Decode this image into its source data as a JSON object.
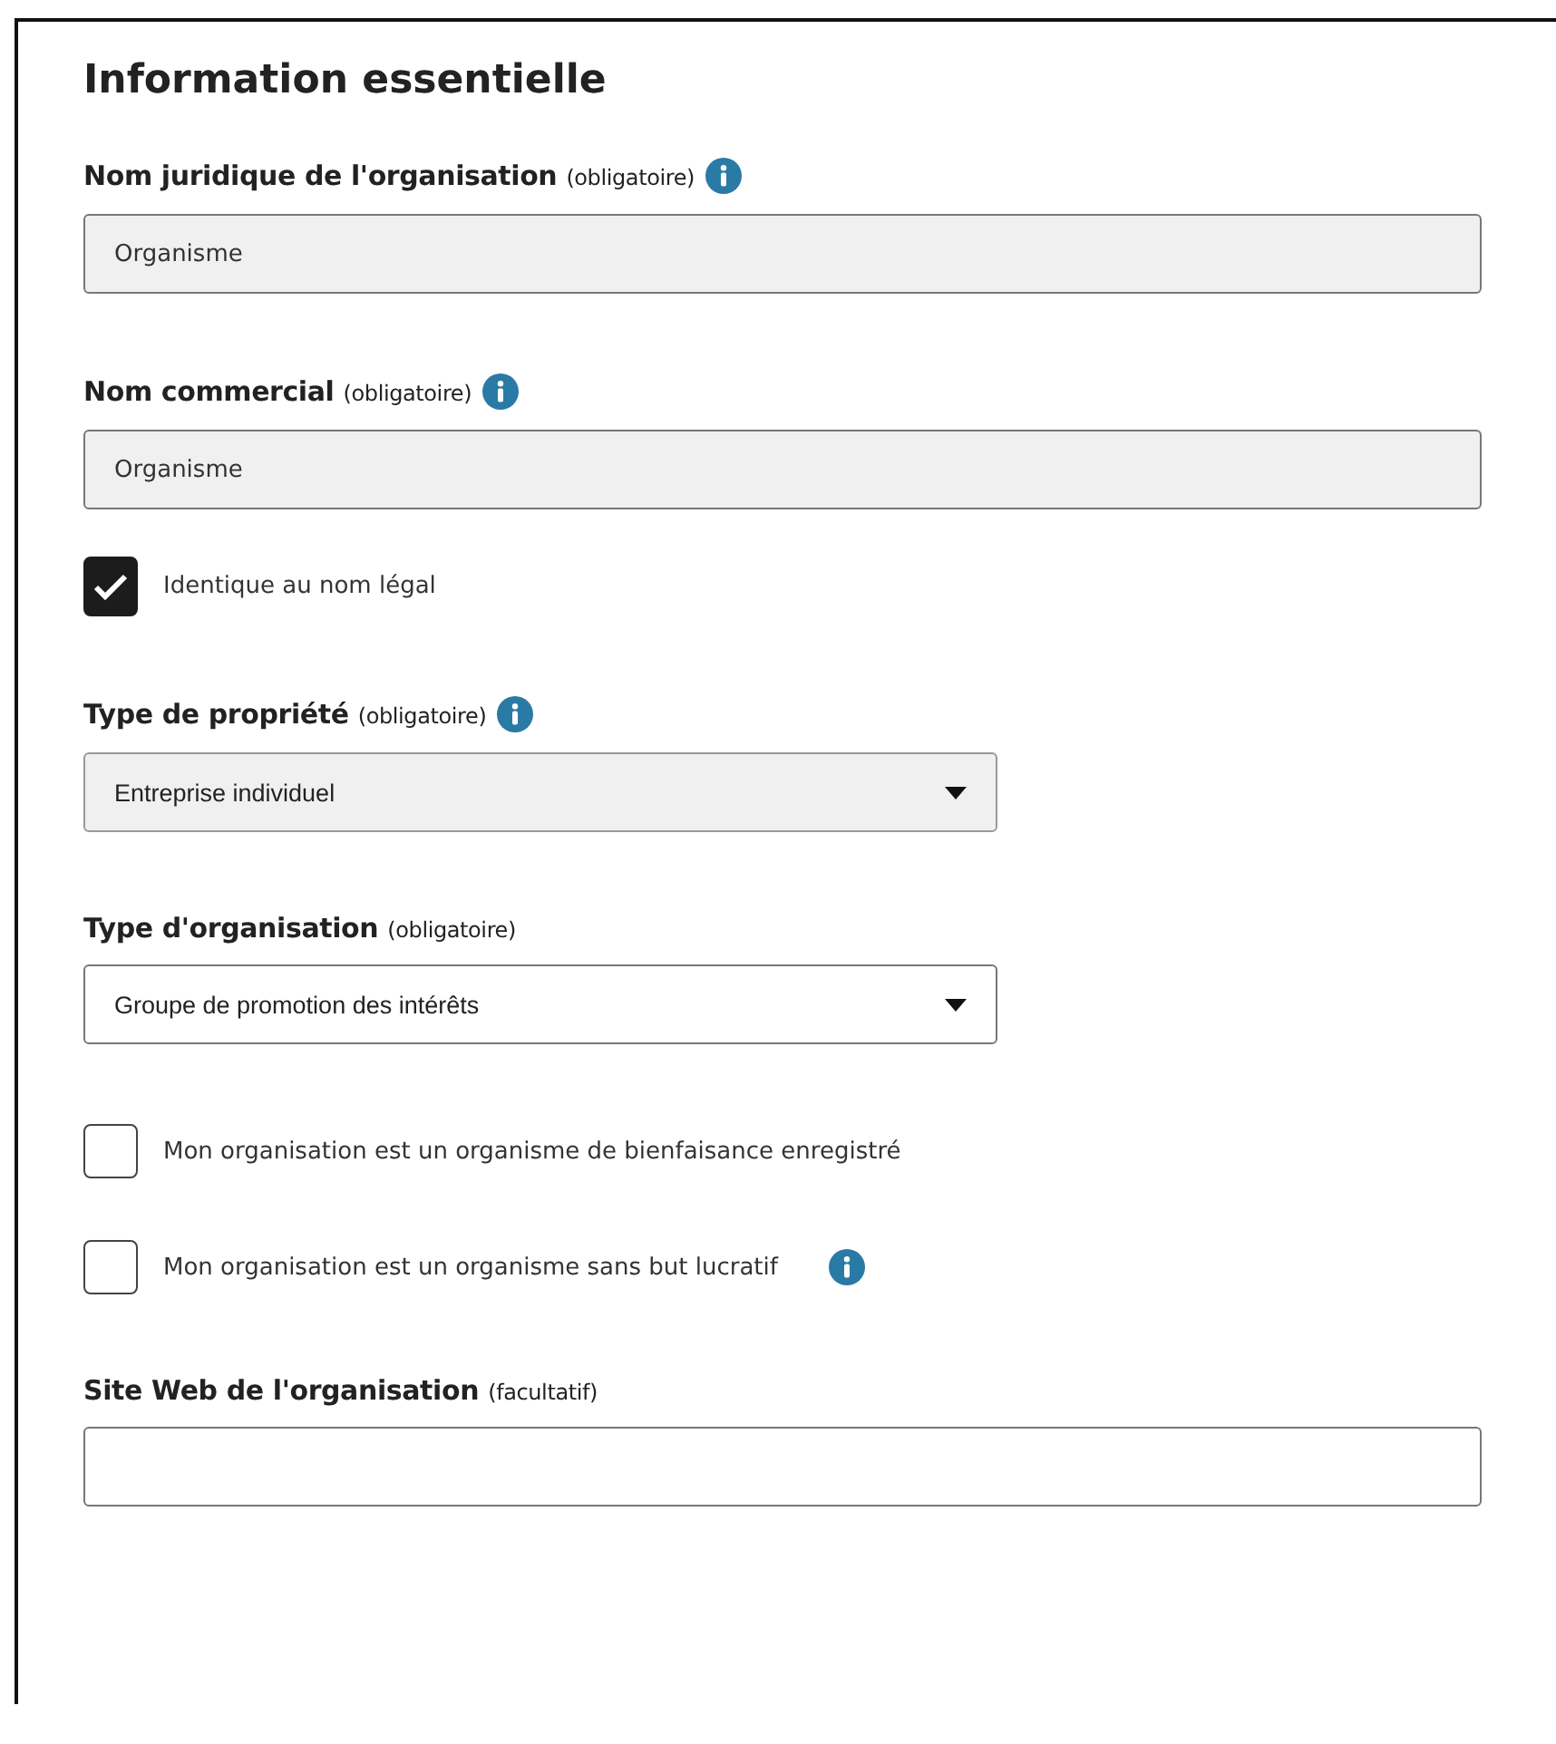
{
  "heading": "Information essentielle",
  "items": [
    {
      "kind": "field",
      "label": "Nom juridique de l'organisation",
      "note": "(obligatoire)",
      "info": true,
      "value": "Organisme",
      "disabled": true
    },
    {
      "kind": "field",
      "label": "Nom commercial",
      "note": "(obligatoire)",
      "info": true,
      "value": "Organisme",
      "disabled": true
    },
    {
      "kind": "checkbox",
      "label": "Identique au nom légal",
      "checked": true,
      "info": false
    },
    {
      "kind": "select",
      "label": "Type de propriété",
      "note": "(obligatoire)",
      "info": true,
      "value": "Entreprise individuel",
      "disabled": true
    },
    {
      "kind": "select",
      "label": "Type d'organisation",
      "note": "(obligatoire)",
      "info": false,
      "value": "Groupe de promotion des intérêts",
      "disabled": false
    },
    {
      "kind": "checkbox",
      "label": "Mon organisation est un organisme de bienfaisance enregistré",
      "checked": false,
      "info": false
    },
    {
      "kind": "checkbox",
      "label": "Mon organisation est un organisme sans but lucratif",
      "checked": false,
      "info": true
    },
    {
      "kind": "field",
      "label": "Site Web de l'organisation",
      "note": "(facultatif)",
      "info": false,
      "disabled": false
    }
  ]
}
